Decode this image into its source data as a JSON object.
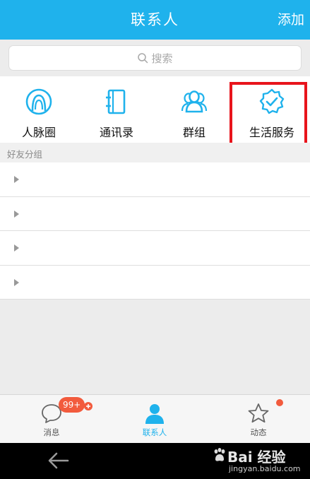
{
  "header": {
    "title": "联系人",
    "add_label": "添加"
  },
  "search": {
    "placeholder": "搜索"
  },
  "quick_entries": [
    {
      "label": "人脉圈",
      "icon": "contacts-circle-icon"
    },
    {
      "label": "通讯录",
      "icon": "address-book-icon"
    },
    {
      "label": "群组",
      "icon": "group-icon"
    },
    {
      "label": "生活服务",
      "icon": "verified-badge-icon"
    }
  ],
  "friends_section": {
    "title": "好友分组",
    "rows": 4
  },
  "tabbar": {
    "tabs": [
      {
        "label": "消息",
        "icon": "chat-bubble-icon",
        "badge": "99+"
      },
      {
        "label": "联系人",
        "icon": "person-icon",
        "active": true
      },
      {
        "label": "动态",
        "icon": "star-icon",
        "dot": true
      }
    ]
  },
  "watermark": {
    "main": "Bai 经验",
    "sub": "jingyan.baidu.com"
  },
  "colors": {
    "accent": "#1fb2ec",
    "badge": "#f25b3d",
    "highlight": "#e8141c"
  }
}
